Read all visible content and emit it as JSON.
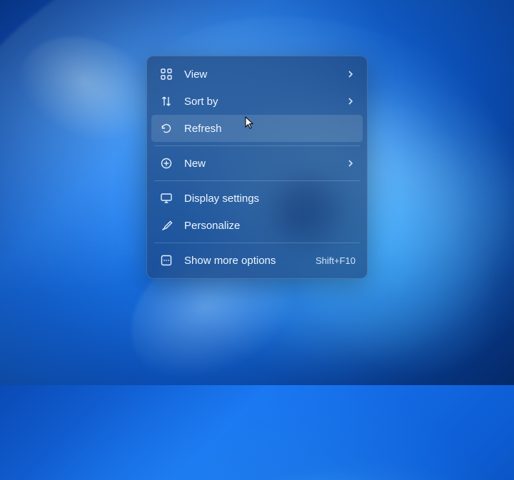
{
  "context_menu": {
    "items": {
      "view": {
        "label": "View",
        "has_submenu": true
      },
      "sort_by": {
        "label": "Sort by",
        "has_submenu": true
      },
      "refresh": {
        "label": "Refresh",
        "has_submenu": false
      },
      "new": {
        "label": "New",
        "has_submenu": true
      },
      "display_settings": {
        "label": "Display settings",
        "has_submenu": false
      },
      "personalize": {
        "label": "Personalize",
        "has_submenu": false
      },
      "show_more_options": {
        "label": "Show more options",
        "shortcut": "Shift+F10",
        "has_submenu": false
      }
    },
    "hovered_item": "refresh"
  }
}
